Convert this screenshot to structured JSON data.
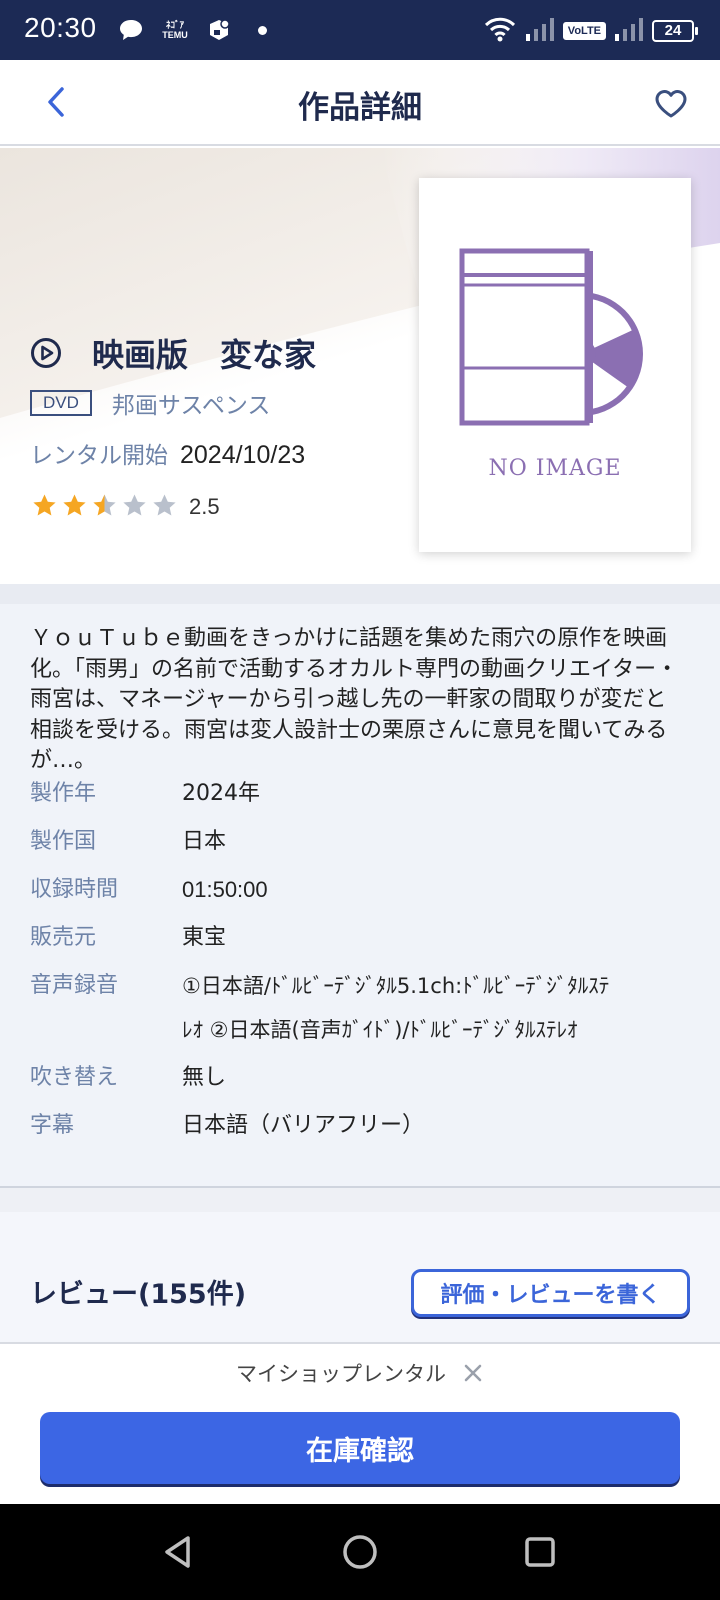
{
  "status_bar": {
    "time": "20:30",
    "app_icons": [
      "chat-bubble-icon",
      "temu-icon",
      "app-cube-icon"
    ],
    "temu_line1": "ﾈｺﾞｱ",
    "temu_line2": "TEMU",
    "network_label": "VoLTE",
    "battery": "24"
  },
  "header": {
    "title": "作品詳細",
    "back_icon": "chevron-left-icon",
    "favorite_icon": "heart-outline-icon"
  },
  "work": {
    "title": "映画版　変な家",
    "format": "DVD",
    "genre": "邦画サスペンス",
    "rental_label": "レンタル開始",
    "rental_date": "2024/10/23",
    "rating": "2.5",
    "rating_value": 2.5,
    "rating_max": 5,
    "poster_text": "NO IMAGE"
  },
  "synopsis": "ＹｏｕＴｕｂｅ動画をきっかけに話題を集めた雨穴の原作を映画化。「雨男」の名前で活動するオカルト専門の動画クリエイター・雨宮は、マネージャーから引っ越し先の一軒家の間取りが変だと相談を受ける。雨宮は変人設計士の栗原さんに意見を聞いてみるが…。",
  "specs": {
    "year_label": "製作年",
    "year": "2024年",
    "country_label": "製作国",
    "country": "日本",
    "runtime_label": "収録時間",
    "runtime": "01:50:00",
    "distributor_label": "販売元",
    "distributor": "東宝",
    "audio_label": "音声録音",
    "audio_line1": "①日本語/ﾄﾞﾙﾋﾞｰﾃﾞｼﾞﾀﾙ5.1ch:ﾄﾞﾙﾋﾞｰﾃﾞｼﾞﾀﾙｽﾃ",
    "audio_line2": "ﾚｵ ②日本語(音声ｶﾞｲﾄﾞ)/ﾄﾞﾙﾋﾞｰﾃﾞｼﾞﾀﾙｽﾃﾚｵ",
    "dub_label": "吹き替え",
    "dub": "無し",
    "subtitle_label": "字幕",
    "subtitle": "日本語（バリアフリー）"
  },
  "review": {
    "title": "レビュー(155件)",
    "write_button": "評価・レビューを書く"
  },
  "bottom": {
    "shop_label": "マイショップレンタル",
    "stock_button": "在庫確認"
  },
  "colors": {
    "primary": "#3c66e4",
    "navy": "#1f2a4d",
    "status_bar": "#1c2a55",
    "label_blue": "#6e83a8",
    "star": "#f5a623",
    "star_empty": "#b9c0cc",
    "poster_purple": "#8b6fb2"
  }
}
